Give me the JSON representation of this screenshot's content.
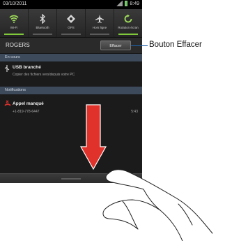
{
  "status_bar": {
    "date": "03/10/2011",
    "time": "8:49"
  },
  "quick_settings": [
    {
      "label": "Wi-Fi",
      "icon": "wifi-icon",
      "on": true
    },
    {
      "label": "Bluetooth",
      "icon": "bluetooth-icon",
      "on": false
    },
    {
      "label": "GPS",
      "icon": "gps-icon",
      "on": false
    },
    {
      "label": "Hors ligne",
      "icon": "airplane-icon",
      "on": false
    },
    {
      "label": "Rotation écran",
      "icon": "rotation-icon",
      "on": true
    }
  ],
  "carrier": {
    "name": "ROGERS",
    "clear_label": "Effacer"
  },
  "ongoing": {
    "header": "En cours",
    "item": {
      "title": "USB branché",
      "subtitle": "Copier des fichiers vers/depuis votre PC",
      "icon": "usb-icon"
    }
  },
  "notifications": {
    "header": "Notifications",
    "item": {
      "title": "Appel manqué",
      "subtitle": "+1-819-778-6447",
      "time": "5:43",
      "icon": "missed-call-icon"
    }
  },
  "callout": {
    "label": "Bouton Effacer"
  },
  "gesture": {
    "arrow": "down-arrow-icon",
    "hand": "hand-icon"
  },
  "colors": {
    "accent_green": "#7fc93b",
    "arrow_red": "#e0322b",
    "callout_blue": "#1d5fa8",
    "section_blue": "#3d4a5c"
  }
}
